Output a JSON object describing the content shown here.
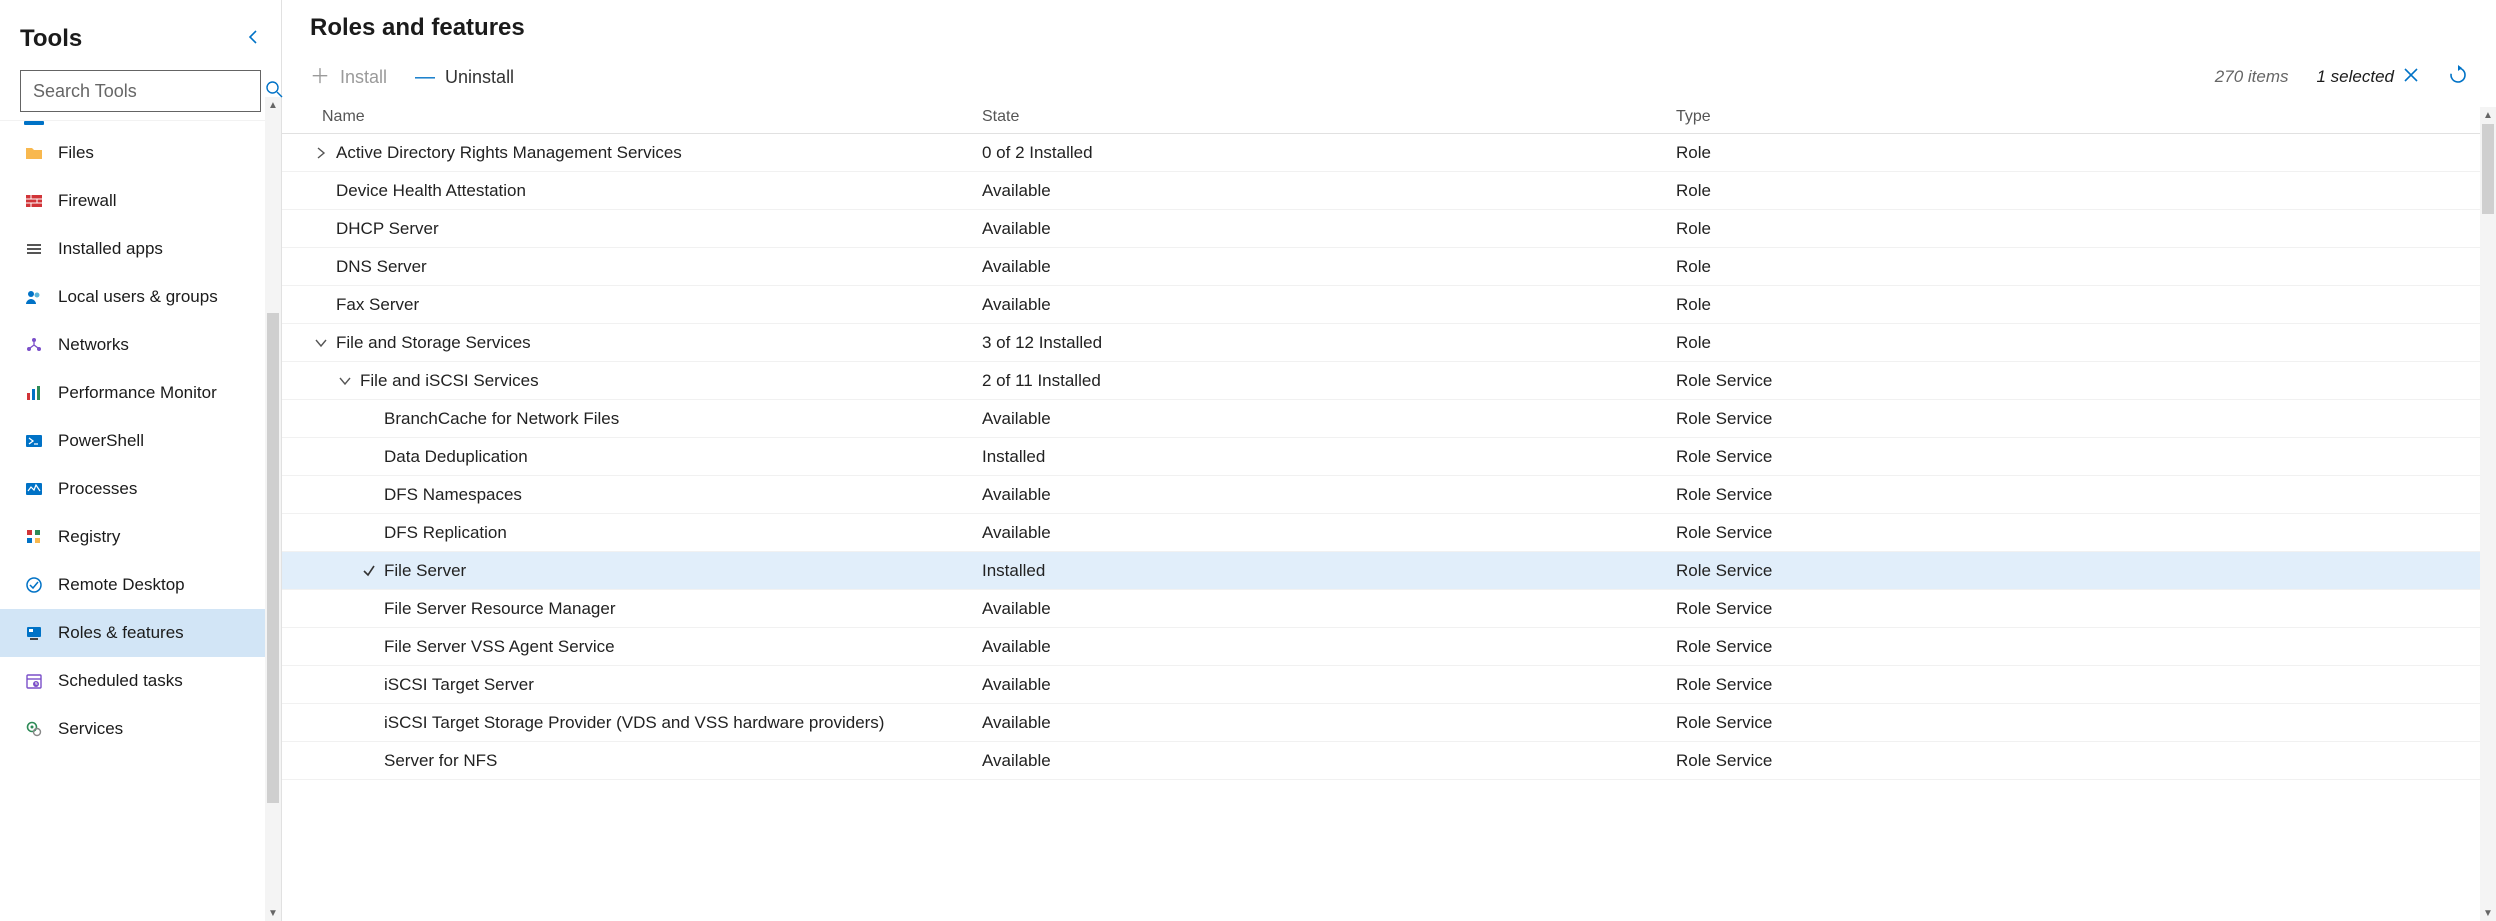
{
  "sidebar": {
    "title": "Tools",
    "search_placeholder": "Search Tools",
    "items": [
      {
        "label": "Files",
        "icon": "folder"
      },
      {
        "label": "Firewall",
        "icon": "firewall"
      },
      {
        "label": "Installed apps",
        "icon": "apps"
      },
      {
        "label": "Local users & groups",
        "icon": "users"
      },
      {
        "label": "Networks",
        "icon": "network"
      },
      {
        "label": "Performance Monitor",
        "icon": "perf"
      },
      {
        "label": "PowerShell",
        "icon": "powershell"
      },
      {
        "label": "Processes",
        "icon": "processes"
      },
      {
        "label": "Registry",
        "icon": "registry"
      },
      {
        "label": "Remote Desktop",
        "icon": "remote"
      },
      {
        "label": "Roles & features",
        "icon": "roles",
        "selected": true
      },
      {
        "label": "Scheduled tasks",
        "icon": "schedule"
      },
      {
        "label": "Services",
        "icon": "services"
      }
    ]
  },
  "main": {
    "title": "Roles and features",
    "actions": {
      "install_label": "Install",
      "uninstall_label": "Uninstall"
    },
    "status": {
      "items_count": "270 items",
      "selected_text": "1 selected"
    },
    "columns": {
      "name": "Name",
      "state": "State",
      "type": "Type"
    },
    "rows": [
      {
        "indent": 1,
        "expand": "right",
        "name": "Active Directory Rights Management Services",
        "state": "0 of 2 Installed",
        "type": "Role"
      },
      {
        "indent": 1,
        "expand": "",
        "name": "Device Health Attestation",
        "state": "Available",
        "type": "Role"
      },
      {
        "indent": 1,
        "expand": "",
        "name": "DHCP Server",
        "state": "Available",
        "type": "Role"
      },
      {
        "indent": 1,
        "expand": "",
        "name": "DNS Server",
        "state": "Available",
        "type": "Role"
      },
      {
        "indent": 1,
        "expand": "",
        "name": "Fax Server",
        "state": "Available",
        "type": "Role"
      },
      {
        "indent": 1,
        "expand": "down",
        "name": "File and Storage Services",
        "state": "3 of 12 Installed",
        "type": "Role"
      },
      {
        "indent": 2,
        "expand": "down",
        "name": "File and iSCSI Services",
        "state": "2 of 11 Installed",
        "type": "Role Service"
      },
      {
        "indent": 3,
        "expand": "",
        "name": "BranchCache for Network Files",
        "state": "Available",
        "type": "Role Service"
      },
      {
        "indent": 3,
        "expand": "",
        "name": "Data Deduplication",
        "state": "Installed",
        "type": "Role Service"
      },
      {
        "indent": 3,
        "expand": "",
        "name": "DFS Namespaces",
        "state": "Available",
        "type": "Role Service"
      },
      {
        "indent": 3,
        "expand": "",
        "name": "DFS Replication",
        "state": "Available",
        "type": "Role Service"
      },
      {
        "indent": 3,
        "expand": "check",
        "name": "File Server",
        "state": "Installed",
        "type": "Role Service",
        "selected": true
      },
      {
        "indent": 3,
        "expand": "",
        "name": "File Server Resource Manager",
        "state": "Available",
        "type": "Role Service"
      },
      {
        "indent": 3,
        "expand": "",
        "name": "File Server VSS Agent Service",
        "state": "Available",
        "type": "Role Service"
      },
      {
        "indent": 3,
        "expand": "",
        "name": "iSCSI Target Server",
        "state": "Available",
        "type": "Role Service"
      },
      {
        "indent": 3,
        "expand": "",
        "name": "iSCSI Target Storage Provider (VDS and VSS hardware providers)",
        "state": "Available",
        "type": "Role Service"
      },
      {
        "indent": 3,
        "expand": "",
        "name": "Server for NFS",
        "state": "Available",
        "type": "Role Service"
      }
    ]
  }
}
